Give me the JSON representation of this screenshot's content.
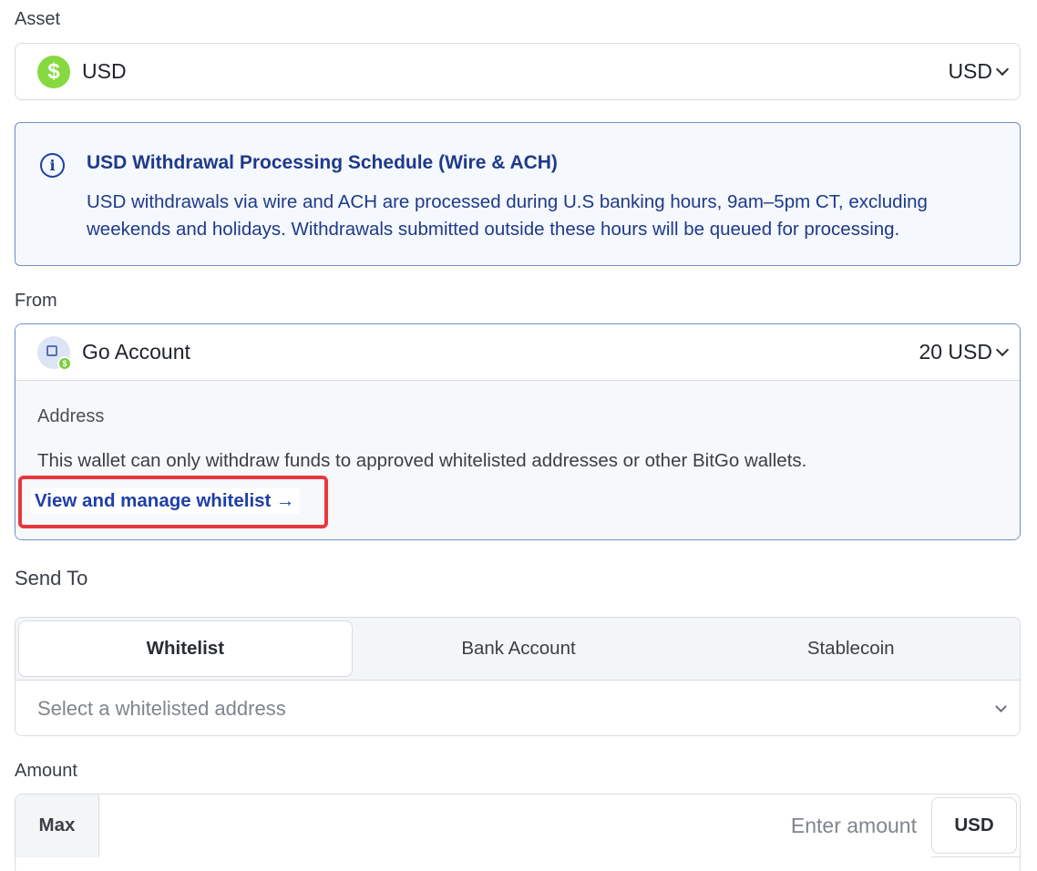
{
  "asset": {
    "label": "Asset",
    "selected_name": "USD",
    "selected_code": "USD",
    "icon": "dollar-coin-icon"
  },
  "info_banner": {
    "icon": "info-icon",
    "title": "USD Withdrawal Processing Schedule (Wire & ACH)",
    "body": "USD withdrawals via wire and ACH are processed during U.S banking hours, 9am–5pm CT, excluding weekends and holidays. Withdrawals submitted outside these hours will be queued for processing."
  },
  "from": {
    "label": "From",
    "account_name": "Go Account",
    "balance": "20 USD",
    "address_label": "Address",
    "address_note": "This wallet can only withdraw funds to approved whitelisted addresses or other BitGo wallets.",
    "whitelist_link": "View and manage whitelist →"
  },
  "send_to": {
    "title": "Send To",
    "tabs": [
      "Whitelist",
      "Bank Account",
      "Stablecoin"
    ],
    "active_tab": "Whitelist",
    "select_placeholder": "Select a whitelisted address"
  },
  "amount": {
    "label": "Amount",
    "max_label": "Max",
    "placeholder": "Enter amount",
    "unit": "USD"
  },
  "colors": {
    "accent_blue": "#1e3fa8",
    "highlight_red": "#e5383f",
    "usd_green": "#86d93f"
  }
}
